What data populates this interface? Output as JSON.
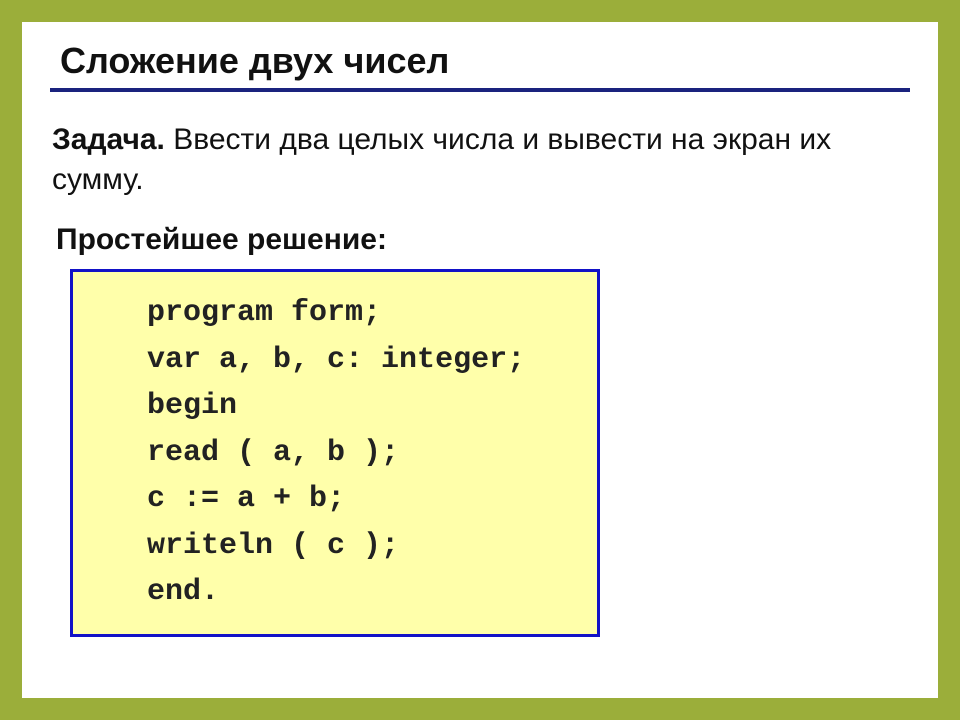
{
  "title": "Сложение двух чисел",
  "task": {
    "label": "Задача.",
    "text": " Ввести два целых числа и вывести на экран их сумму."
  },
  "solution_label": "Простейшее решение:",
  "code": "   program form;\n   var a, b, c: integer;\n   begin\n   read ( a, b );\n   c := a + b;\n   writeln ( c );\n   end."
}
